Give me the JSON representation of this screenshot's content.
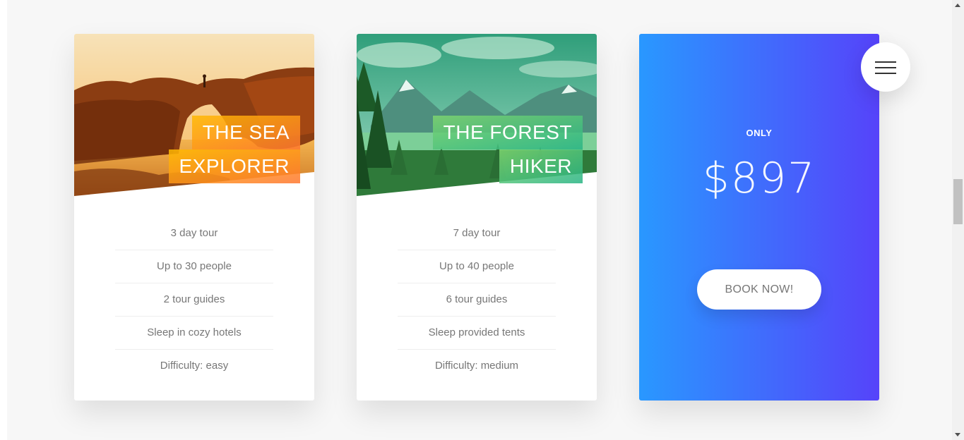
{
  "cards": [
    {
      "title_line1": "THE SEA",
      "title_line2": "EXPLORER",
      "features": [
        "3 day tour",
        "Up to 30 people",
        "2 tour guides",
        "Sleep in cozy hotels",
        "Difficulty: easy"
      ]
    },
    {
      "title_line1": "THE FOREST",
      "title_line2": "HIKER",
      "features": [
        "7 day tour",
        "Up to 40 people",
        "6 tour guides",
        "Sleep provided tents",
        "Difficulty: medium"
      ]
    }
  ],
  "price_card": {
    "only_label": "ONLY",
    "price": "$897",
    "button_label": "BOOK NOW!"
  },
  "icons": {
    "menu": "hamburger-icon"
  },
  "colors": {
    "blue_start": "#2998ff",
    "blue_end": "#5643fa",
    "orange_start": "#ffb900",
    "orange_end": "#ff7730",
    "green_start": "#7ed56f",
    "green_end": "#28b485"
  }
}
